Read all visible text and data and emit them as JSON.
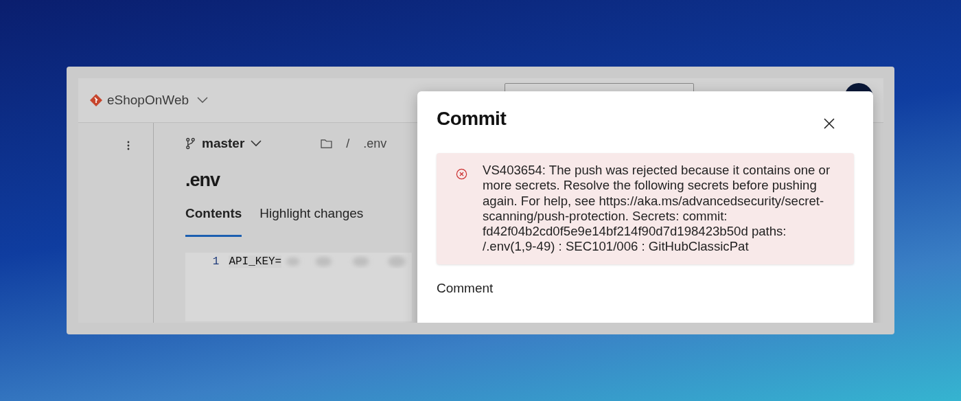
{
  "header": {
    "project": "eShopOnWeb"
  },
  "toolbar": {
    "branch": "master",
    "breadcrumb": [
      {
        "kind": "folder"
      },
      {
        "kind": "separator",
        "text": "/"
      },
      {
        "kind": "file",
        "text": ".env"
      }
    ]
  },
  "file": {
    "title": ".env"
  },
  "tabs": [
    {
      "label": "Contents",
      "selected": true
    },
    {
      "label": "Highlight changes",
      "selected": false
    }
  ],
  "code": {
    "lines": [
      {
        "number": "1",
        "text": "API_KEY="
      }
    ]
  },
  "dialog": {
    "title": "Commit",
    "error": "VS403654: The push was rejected because it contains one or more secrets. Resolve the following secrets before pushing again. For help, see https://aka.ms/advancedsecurity/secret-scanning/push-protection. Secrets: commit: fd42f04b2cd0f5e9e14bf214f90d7d198423b50d paths: /.env(1,9-49) : SEC101/006 : GitHubClassicPat",
    "comment_label": "Comment"
  }
}
